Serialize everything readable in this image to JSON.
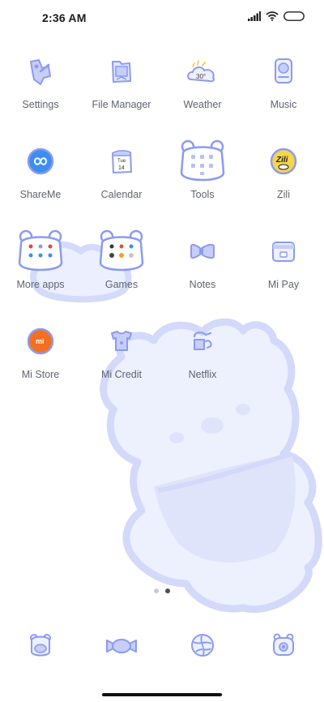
{
  "status_bar": {
    "time": "2:36 AM",
    "icons": [
      "signal-icon",
      "wifi-icon",
      "battery-icon"
    ]
  },
  "apps": [
    {
      "label": "Settings",
      "icon": "settings-icon"
    },
    {
      "label": "File Manager",
      "icon": "folder-icon"
    },
    {
      "label": "Weather",
      "icon": "weather-icon",
      "icon_text": "30°"
    },
    {
      "label": "Music",
      "icon": "music-icon"
    },
    {
      "label": "ShareMe",
      "icon": "shareme-icon"
    },
    {
      "label": "Calendar",
      "icon": "calendar-icon",
      "icon_text_day": "Tue",
      "icon_text_date": "14"
    },
    {
      "label": "Tools",
      "icon": "tools-folder-icon"
    },
    {
      "label": "Zili",
      "icon": "zili-icon",
      "icon_text": "Zili"
    },
    {
      "label": "More apps",
      "icon": "more-apps-folder-icon"
    },
    {
      "label": "Games",
      "icon": "games-folder-icon"
    },
    {
      "label": "Notes",
      "icon": "notes-icon"
    },
    {
      "label": "Mi Pay",
      "icon": "mi-pay-icon"
    },
    {
      "label": "Mi Store",
      "icon": "mi-store-icon",
      "icon_text": "mi"
    },
    {
      "label": "Mi Credit",
      "icon": "mi-credit-icon"
    },
    {
      "label": "Netflix",
      "icon": "netflix-icon"
    }
  ],
  "page_indicator": {
    "pages": 2,
    "current": 2
  },
  "dock": [
    {
      "icon": "phone-bear-icon"
    },
    {
      "icon": "messages-candy-icon"
    },
    {
      "icon": "browser-icon"
    },
    {
      "icon": "camera-icon"
    }
  ],
  "colors": {
    "accent": "#8b9bf0",
    "accent_light": "#dfe4fb",
    "wallpaper": "#e9ecfc",
    "label": "#5f6470"
  }
}
